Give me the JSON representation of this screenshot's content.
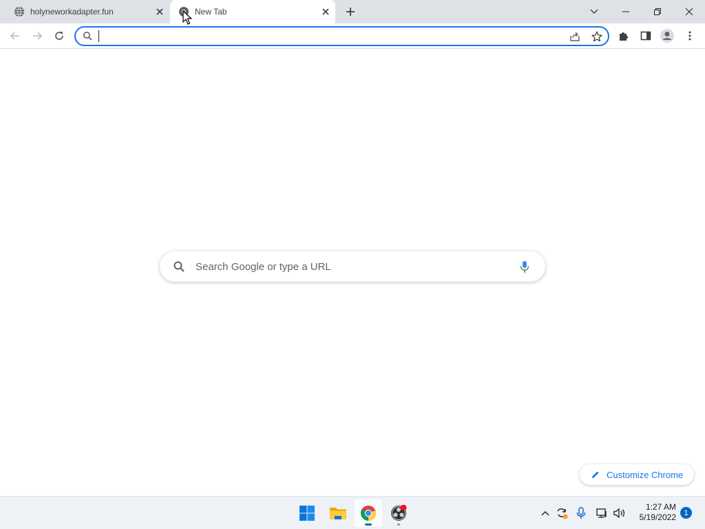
{
  "tabs": [
    {
      "title": "holyneworkadapter.fun",
      "favicon": "globe-icon",
      "active": false
    },
    {
      "title": "New Tab",
      "favicon": "chrome-newtab-icon",
      "active": true
    }
  ],
  "omnibox": {
    "value": "",
    "placeholder": ""
  },
  "ntp": {
    "search_placeholder": "Search Google or type a URL",
    "customize_label": "Customize Chrome"
  },
  "taskbar": {
    "apps": [
      {
        "name": "start-button",
        "icon": "windows-logo-icon"
      },
      {
        "name": "file-explorer",
        "icon": "folder-icon"
      },
      {
        "name": "google-chrome",
        "icon": "chrome-icon",
        "active": true
      },
      {
        "name": "obs-studio",
        "icon": "obs-icon",
        "recording": true
      }
    ],
    "clock": {
      "time": "1:27 AM",
      "date": "5/19/2022"
    },
    "notification_count": "1"
  },
  "colors": {
    "accent": "#1a73e8",
    "tabstrip": "#dee1e6",
    "taskbar": "#eef1f6"
  }
}
